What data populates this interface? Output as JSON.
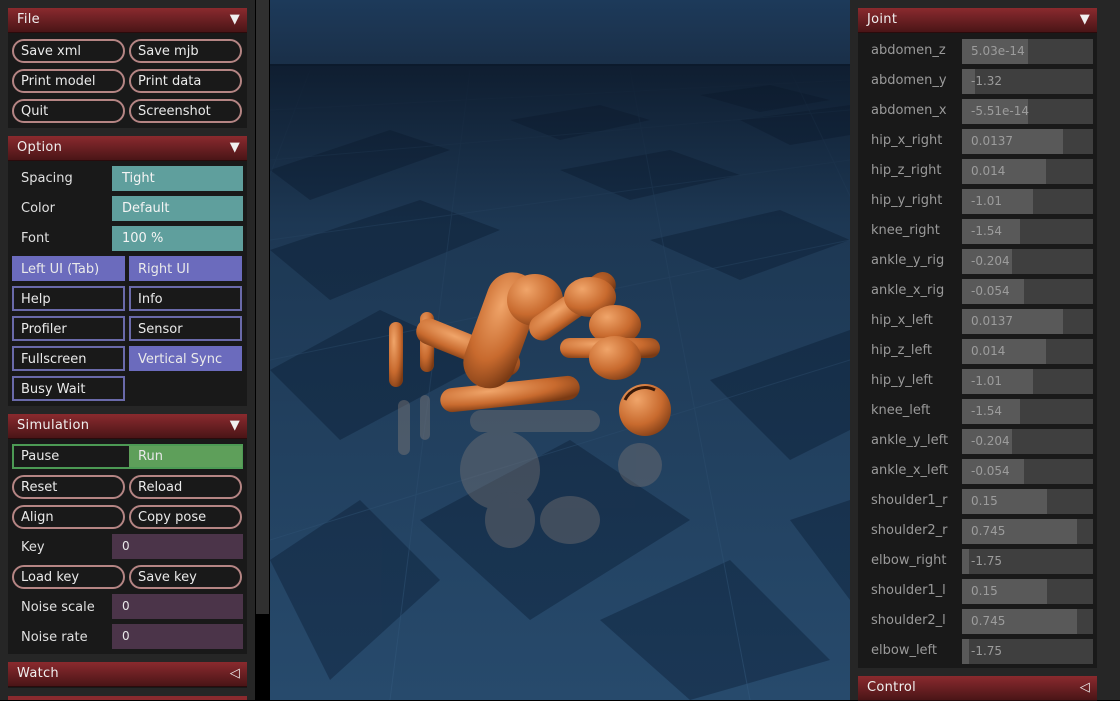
{
  "left_panel": {
    "file": {
      "title": "File",
      "buttons": [
        "Save xml",
        "Save mjb",
        "Print model",
        "Print data",
        "Quit",
        "Screenshot"
      ]
    },
    "option": {
      "title": "Option",
      "spacing_label": "Spacing",
      "spacing_value": "Tight",
      "color_label": "Color",
      "color_value": "Default",
      "font_label": "Font",
      "font_value": "100 %",
      "toggles": [
        {
          "label": "Left UI (Tab)",
          "on": true
        },
        {
          "label": "Right UI",
          "on": true
        },
        {
          "label": "Help",
          "on": false
        },
        {
          "label": "Info",
          "on": false
        },
        {
          "label": "Profiler",
          "on": false
        },
        {
          "label": "Sensor",
          "on": false
        },
        {
          "label": "Fullscreen",
          "on": false
        },
        {
          "label": "Vertical Sync",
          "on": true
        },
        {
          "label": "Busy Wait",
          "on": false
        }
      ]
    },
    "simulation": {
      "title": "Simulation",
      "pause_label": "Pause",
      "run_label": "Run",
      "reset_label": "Reset",
      "reload_label": "Reload",
      "align_label": "Align",
      "copy_pose_label": "Copy pose",
      "key_label": "Key",
      "key_value": "0",
      "load_key_label": "Load key",
      "save_key_label": "Save key",
      "noise_scale_label": "Noise scale",
      "noise_scale_value": "0",
      "noise_rate_label": "Noise rate",
      "noise_rate_value": "0"
    },
    "watch": {
      "title": "Watch"
    }
  },
  "right_panel": {
    "joint": {
      "title": "Joint",
      "rows": [
        {
          "name": "abdomen_z",
          "value": "5.03e-14",
          "fill": 0.5
        },
        {
          "name": "abdomen_y",
          "value": "-1.32",
          "fill": 0.1
        },
        {
          "name": "abdomen_x",
          "value": "-5.51e-14",
          "fill": 0.5
        },
        {
          "name": "hip_x_right",
          "value": "0.0137",
          "fill": 0.77
        },
        {
          "name": "hip_z_right",
          "value": "0.014",
          "fill": 0.64
        },
        {
          "name": "hip_y_right",
          "value": "-1.01",
          "fill": 0.54
        },
        {
          "name": "knee_right",
          "value": "-1.54",
          "fill": 0.44
        },
        {
          "name": "ankle_y_rig",
          "value": "-0.204",
          "fill": 0.38
        },
        {
          "name": "ankle_x_rig",
          "value": "-0.054",
          "fill": 0.47
        },
        {
          "name": "hip_x_left",
          "value": "0.0137",
          "fill": 0.77
        },
        {
          "name": "hip_z_left",
          "value": "0.014",
          "fill": 0.64
        },
        {
          "name": "hip_y_left",
          "value": "-1.01",
          "fill": 0.54
        },
        {
          "name": "knee_left",
          "value": "-1.54",
          "fill": 0.44
        },
        {
          "name": "ankle_y_left",
          "value": "-0.204",
          "fill": 0.38
        },
        {
          "name": "ankle_x_left",
          "value": "-0.054",
          "fill": 0.47
        },
        {
          "name": "shoulder1_r",
          "value": "0.15",
          "fill": 0.65
        },
        {
          "name": "shoulder2_r",
          "value": "0.745",
          "fill": 0.88
        },
        {
          "name": "elbow_right",
          "value": "-1.75",
          "fill": 0.05
        },
        {
          "name": "shoulder1_l",
          "value": "0.15",
          "fill": 0.65
        },
        {
          "name": "shoulder2_l",
          "value": "0.745",
          "fill": 0.88
        },
        {
          "name": "elbow_left",
          "value": "-1.75",
          "fill": 0.05
        }
      ]
    },
    "control": {
      "title": "Control"
    }
  }
}
